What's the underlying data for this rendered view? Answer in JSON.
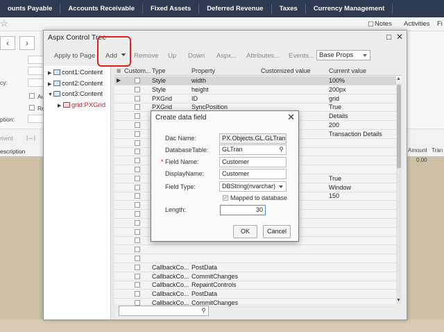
{
  "top_nav": [
    "ounts Payable",
    "Accounts Receivable",
    "Fixed Assets",
    "Deferred Revenue",
    "Taxes",
    "Currency Management"
  ],
  "toolbar2": {
    "notes": "Notes",
    "activities": "Activities",
    "files": "Fi"
  },
  "background": {
    "grid_headers": {
      "description": "escription",
      "amount": "Amount",
      "tran": "Tran"
    },
    "amount_value": "0.00",
    "labels": {
      "cy": "cy:",
      "ption": "ption:",
      "au": "Au",
      "re": "Re",
      "ment": "ment"
    }
  },
  "dialog": {
    "title": "Aspx Control Tree",
    "toolbar": {
      "apply": "Apply to Page",
      "add": "Add",
      "remove": "Remove",
      "up": "Up",
      "down": "Down",
      "aspx": "Aspx...",
      "attributes": "Attributes...",
      "events": "Events...",
      "props_select": "Base Props"
    },
    "tree": [
      {
        "label": "cont1:Content"
      },
      {
        "label": "cont2:Content"
      },
      {
        "label": "cont3:Content"
      },
      {
        "label": "grid:PXGrid"
      }
    ],
    "grid": {
      "headers": {
        "customized": "Custom...",
        "type": "Type",
        "property": "Property",
        "customized_value": "Customized value",
        "current_value": "Current value"
      },
      "rows": [
        {
          "type": "Style",
          "property": "width",
          "current": "100%"
        },
        {
          "type": "Style",
          "property": "height",
          "current": "200px"
        },
        {
          "type": "PXGrid",
          "property": "ID",
          "current": "grid"
        },
        {
          "type": "PXGrid",
          "property": "SyncPosition",
          "current": "True"
        },
        {
          "type": "",
          "property": "",
          "current": "Details"
        },
        {
          "type": "",
          "property": "",
          "current": "200"
        },
        {
          "type": "",
          "property": "",
          "current": "Transaction Details"
        },
        {
          "type": "",
          "property": "",
          "current": ""
        },
        {
          "type": "",
          "property": "",
          "current": ""
        },
        {
          "type": "",
          "property": "",
          "current": ""
        },
        {
          "type": "",
          "property": "",
          "current": ""
        },
        {
          "type": "",
          "property": "",
          "current": "True"
        },
        {
          "type": "",
          "property": "",
          "current": "Window"
        },
        {
          "type": "",
          "property": "",
          "current": "150"
        },
        {
          "type": "",
          "property": "",
          "current": ""
        },
        {
          "type": "",
          "property": "",
          "current": ""
        },
        {
          "type": "",
          "property": "",
          "current": ""
        },
        {
          "type": "",
          "property": "",
          "current": ""
        },
        {
          "type": "",
          "property": "",
          "current": ""
        },
        {
          "type": "",
          "property": "",
          "current": ""
        },
        {
          "type": "",
          "property": "",
          "current": ""
        },
        {
          "type": "CallbackCo...",
          "property": "PostData",
          "current": ""
        },
        {
          "type": "CallbackCo...",
          "property": "CommitChanges",
          "current": ""
        },
        {
          "type": "CallbackCo...",
          "property": "RepaintControls",
          "current": ""
        },
        {
          "type": "CallbackCo...",
          "property": "PostData",
          "current": ""
        },
        {
          "type": "CallbackCo...",
          "property": "CommitChanges",
          "current": ""
        }
      ]
    }
  },
  "modal": {
    "title": "Create data field",
    "fields": {
      "dac_name_label": "Dac Name:",
      "dac_name_value": "PX.Objects.GL.GLTran",
      "db_table_label": "DatabaseTable:",
      "db_table_value": "GLTran",
      "field_name_label": "Field Name:",
      "field_name_value": "Customer",
      "display_name_label": "DisplayName:",
      "display_name_value": "Customer",
      "field_type_label": "Field Type:",
      "field_type_value": "DBString(nvarchar)",
      "mapped_label": "Mapped to database",
      "length_label": "Length:",
      "length_value": "30"
    },
    "ok": "OK",
    "cancel": "Cancel"
  },
  "colors": {
    "nav_bg": "#2e3952",
    "highlight_red": "#e02020",
    "tree_red": "#c02020",
    "focus_blue": "#5a8ad6"
  }
}
